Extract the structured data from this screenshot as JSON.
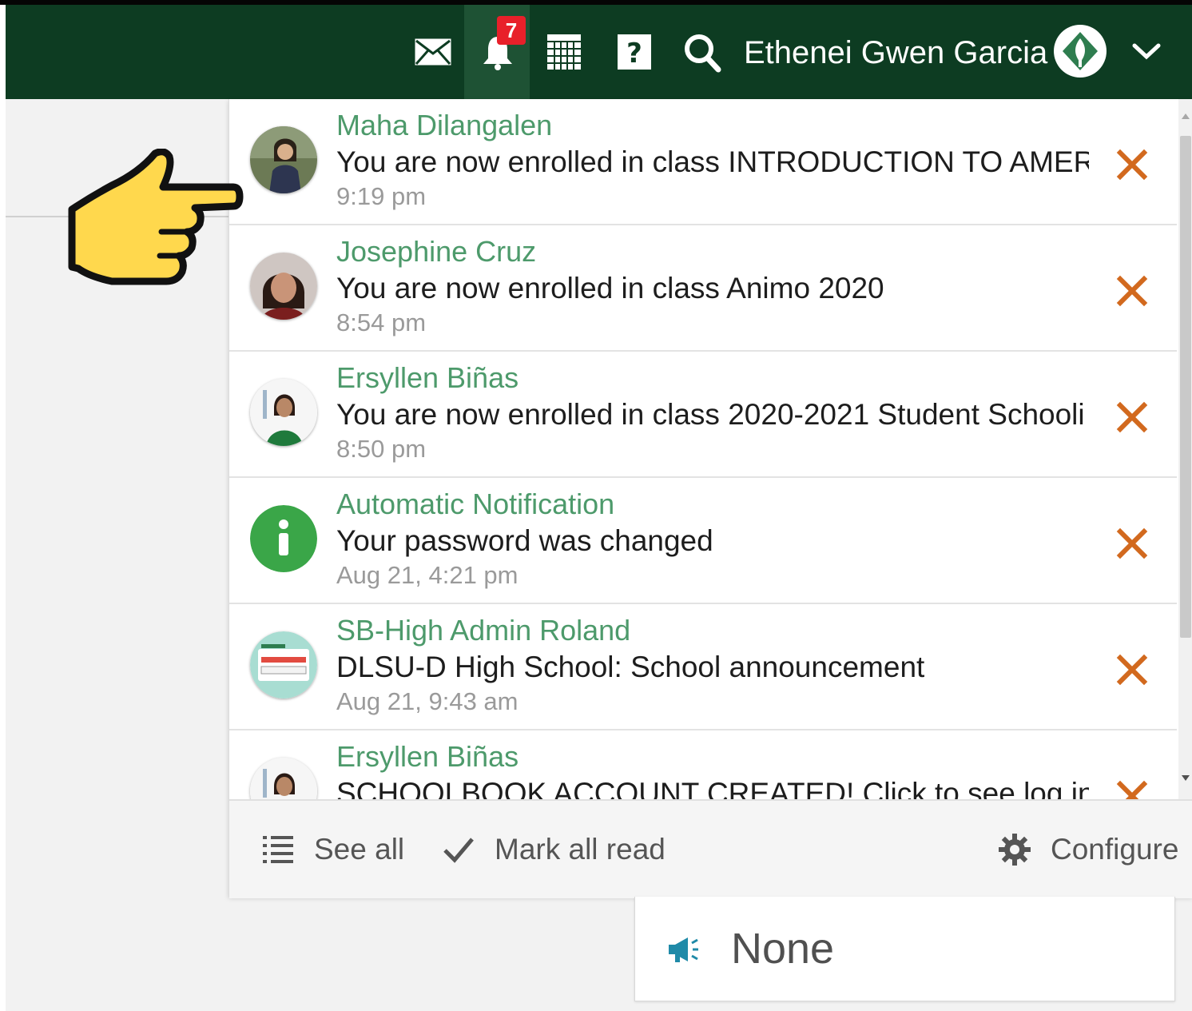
{
  "header": {
    "notification_count": "7",
    "user_name": "Ethenei Gwen Garcia",
    "icons": [
      "mail-icon",
      "bell-icon",
      "calendar-icon",
      "help-icon",
      "search-icon",
      "avatar",
      "chevron-down-icon"
    ]
  },
  "notifications": [
    {
      "sender": "Maha Dilangalen",
      "message": "You are now enrolled in class INTRODUCTION TO AMERI",
      "time": "9:19 pm",
      "avatar": "photo-woman-outdoor"
    },
    {
      "sender": "Josephine Cruz",
      "message": "You are now enrolled in class Animo 2020",
      "time": "8:54 pm",
      "avatar": "photo-woman"
    },
    {
      "sender": "Ersyllen Biñas",
      "message": "You are now enrolled in class 2020-2021 Student Schooli",
      "time": "8:50 pm",
      "avatar": "photo-woman-green"
    },
    {
      "sender": "Automatic Notification",
      "message": "Your password was changed",
      "time": "Aug 21, 4:21 pm",
      "avatar": "info-icon"
    },
    {
      "sender": "SB-High Admin Roland",
      "message": "DLSU-D High School: School announcement",
      "time": "Aug 21, 9:43 am",
      "avatar": "id-badge"
    },
    {
      "sender": "Ersyllen Biñas",
      "message": "SCHOOLBOOK ACCOUNT CREATED! Click to see log in de",
      "time": "",
      "avatar": "photo-woman-green"
    }
  ],
  "footer": {
    "see_all": "See all",
    "mark_all_read": "Mark all read",
    "configure": "Configure"
  },
  "announcement": {
    "text": "None"
  },
  "colors": {
    "header_bg": "#0d3c22",
    "sender": "#4d9a6b",
    "close": "#d2691e",
    "badge": "#e8202a"
  }
}
